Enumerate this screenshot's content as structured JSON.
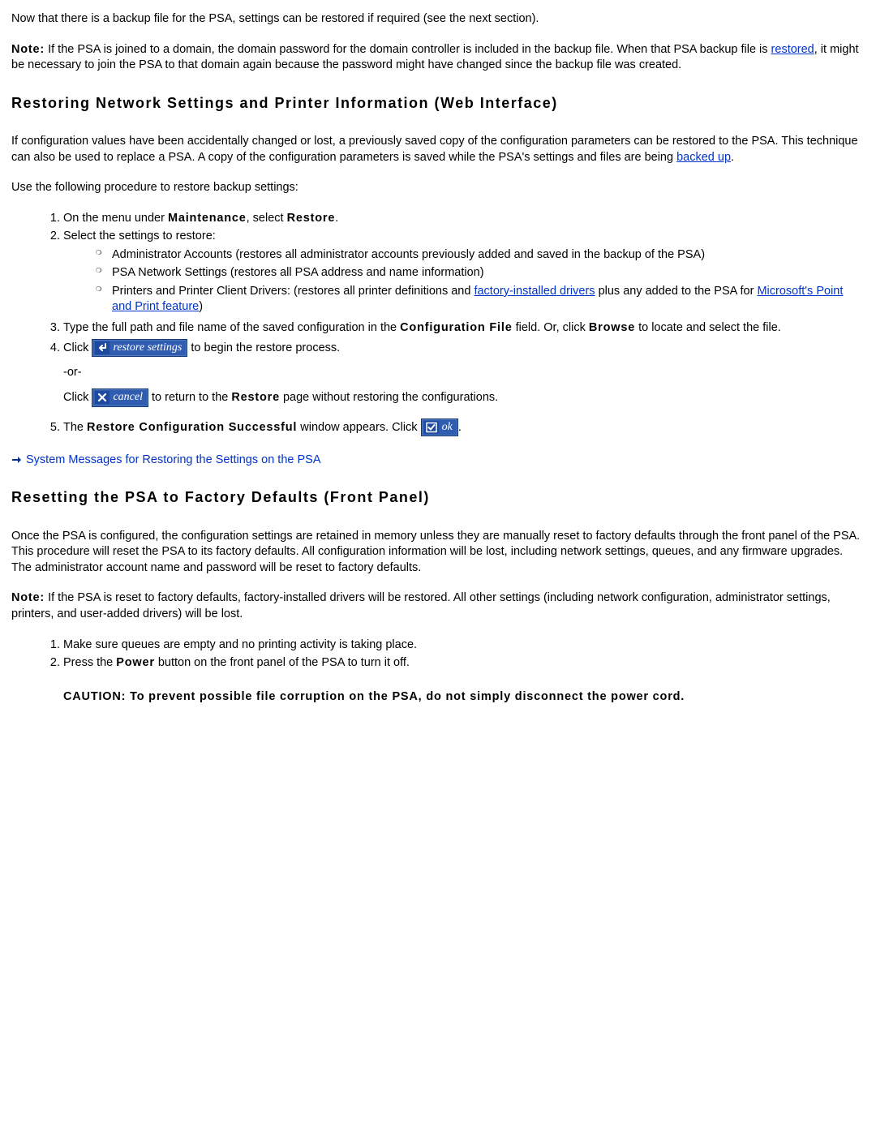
{
  "p_intro": "Now that there is a backup file for the PSA, settings can be restored if required (see the next section).",
  "note1_prefix": "Note:",
  "note1_a": " If the PSA is joined to a domain, the domain password for the domain controller is included in the backup file. When that PSA backup file is ",
  "link_restored": "restored",
  "note1_b": ", it might be necessary to join the PSA to that domain again because the password might have changed since the backup file was created.",
  "h_restoring": "Restoring Network Settings and Printer Information (Web Interface)",
  "p_restoring_a": "If configuration values have been accidentally changed or lost, a previously saved copy of the configuration parameters can be restored to the PSA. This technique can also be used to replace a PSA. A copy of the configuration parameters is saved while the PSA's settings and files are being ",
  "link_backed_up": "backed up",
  "p_restoring_b": ".",
  "p_useproc": "Use the following procedure to restore backup settings:",
  "li1_a": "On the menu under ",
  "li1_b": "Maintenance",
  "li1_c": ", select ",
  "li1_d": "Restore",
  "li1_e": ".",
  "li2": "Select the settings to restore:",
  "sub1": "Administrator Accounts (restores all administrator accounts previously added and saved in the backup of the PSA)",
  "sub2": "PSA Network Settings (restores all PSA address and name information)",
  "sub3_a": "Printers and Printer Client Drivers: (restores all printer definitions and ",
  "link_factory": "factory-installed drivers",
  "sub3_b": " plus any added to the PSA for ",
  "link_msppf": "Microsoft's Point and Print feature",
  "sub3_c": ")",
  "li3_a": "Type the full path and file name of the saved configuration in the ",
  "li3_b": "Configuration File",
  "li3_c": " field. Or, click ",
  "li3_d": "Browse",
  "li3_e": " to locate and select the file.",
  "li4_a": "Click ",
  "btn_restore": "restore settings",
  "li4_b": " to begin the restore process.",
  "or": "-or-",
  "li4c_a": "Click ",
  "btn_cancel": "cancel",
  "li4c_b": " to return to the ",
  "li4c_c": "Restore",
  "li4c_d": " page without restoring the configurations.",
  "li5_a": "The ",
  "li5_b": "Restore Configuration Successful",
  "li5_c": " window appears. Click ",
  "btn_ok": "ok",
  "li5_d": ".",
  "link_sysmsg": "System Messages for Restoring the Settings on the PSA",
  "h_reset": "Resetting the PSA to Factory Defaults (Front Panel)",
  "p_reset1": "Once the PSA is configured, the configuration settings are retained in memory unless they are manually reset to factory defaults through the front panel of the PSA. This procedure will reset the PSA to its factory defaults. All configuration information will be lost, including network settings, queues, and any firmware upgrades. The administrator account name and password will be reset to factory defaults.",
  "note2_prefix": "Note:",
  "note2_body": " If the PSA is reset to factory defaults, factory-installed drivers will be restored. All other settings (including network configuration, administrator settings, printers, and user-added drivers) will be lost.",
  "rli1": "Make sure queues are empty and no printing activity is taking place.",
  "rli2_a": "Press the ",
  "rli2_b": "Power",
  "rli2_c": " button on the front panel of the PSA to turn it off.",
  "caution_a": "CAUTION",
  "caution_b": ": To prevent possible file corruption on the PSA, do not simply disconnect the power cord."
}
